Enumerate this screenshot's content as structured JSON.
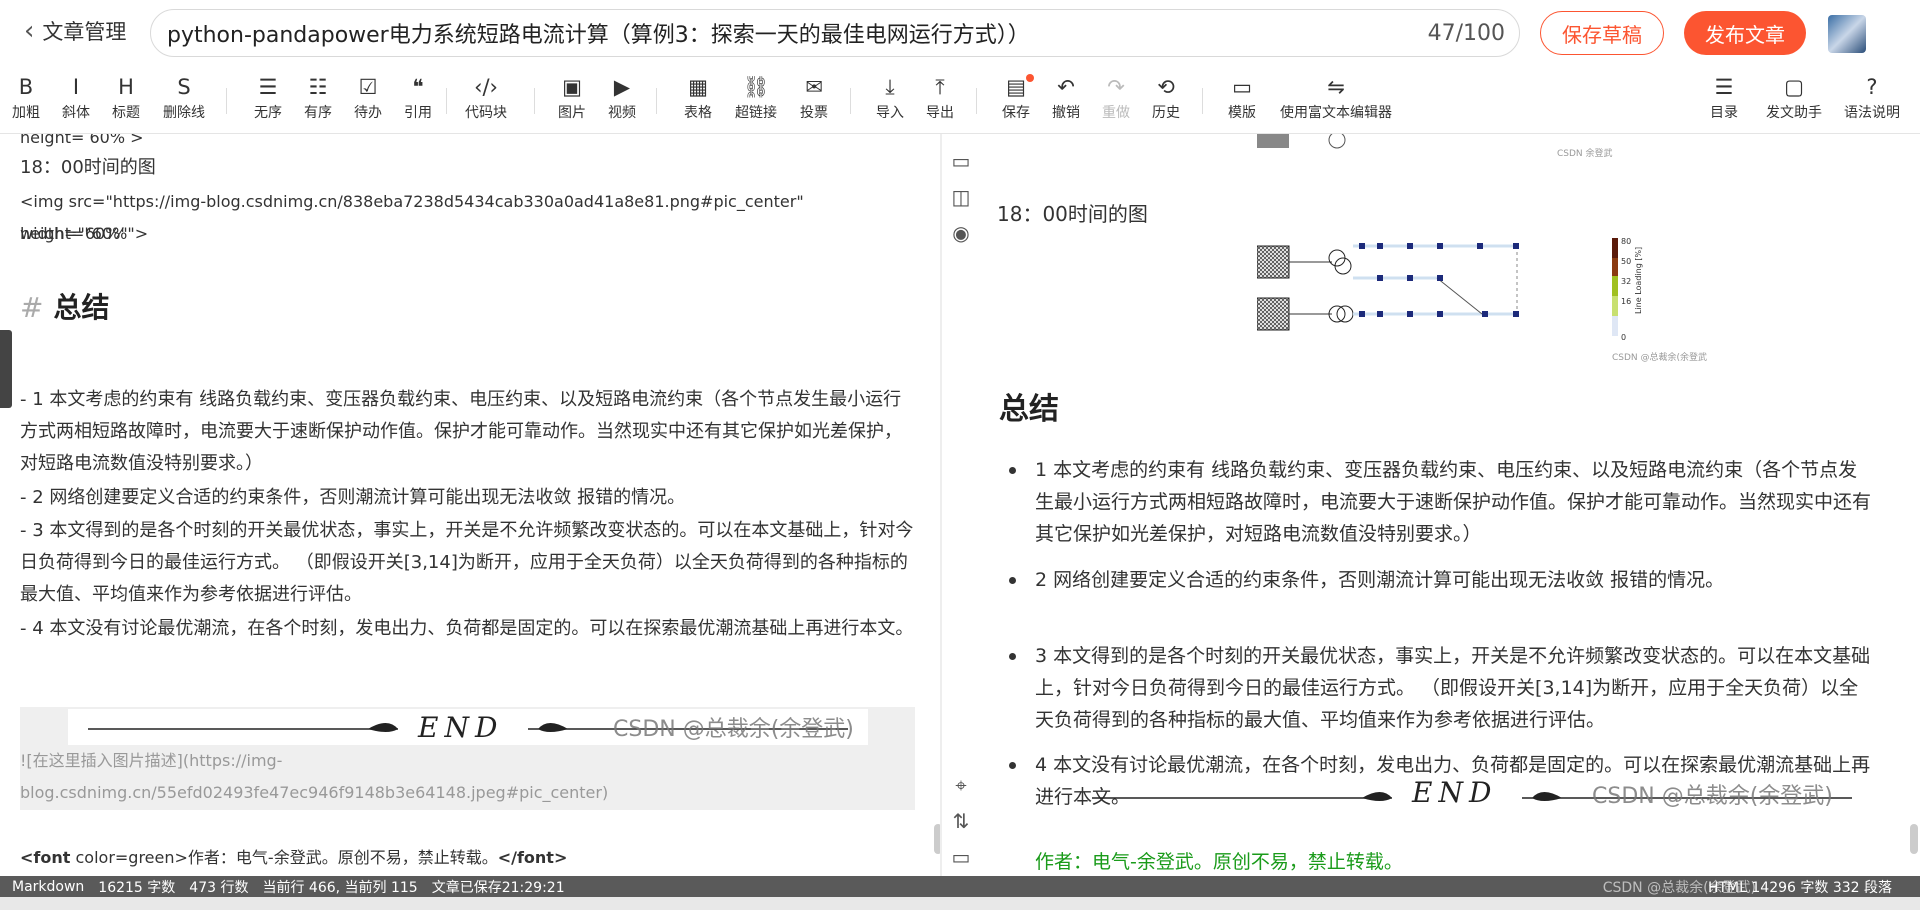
{
  "header": {
    "back_label": "文章管理",
    "title_value": "python-pandapower电力系统短路电流计算（算例3：探索一天的最佳电网运行方式））",
    "title_count": "47/100",
    "save_draft": "保存草稿",
    "publish": "发布文章"
  },
  "toolbar": {
    "items": [
      {
        "label": "加粗",
        "icon": "bold-icon",
        "glyph": "B"
      },
      {
        "label": "斜体",
        "icon": "italic-icon",
        "glyph": "I"
      },
      {
        "label": "标题",
        "icon": "heading-icon",
        "glyph": "H"
      },
      {
        "label": "删除线",
        "icon": "strikethrough-icon",
        "glyph": "S"
      },
      {
        "label": "无序",
        "icon": "unordered-list-icon",
        "glyph": "☰"
      },
      {
        "label": "有序",
        "icon": "ordered-list-icon",
        "glyph": "☷"
      },
      {
        "label": "待办",
        "icon": "todo-list-icon",
        "glyph": "☑"
      },
      {
        "label": "引用",
        "icon": "quote-icon",
        "glyph": "❝"
      },
      {
        "label": "代码块",
        "icon": "code-block-icon",
        "glyph": "‹/›"
      },
      {
        "label": "图片",
        "icon": "image-icon",
        "glyph": "▣"
      },
      {
        "label": "视频",
        "icon": "video-icon",
        "glyph": "▶"
      },
      {
        "label": "表格",
        "icon": "table-icon",
        "glyph": "▦"
      },
      {
        "label": "超链接",
        "icon": "link-icon",
        "glyph": "⛓"
      },
      {
        "label": "投票",
        "icon": "vote-icon",
        "glyph": "✉"
      },
      {
        "label": "导入",
        "icon": "import-icon",
        "glyph": "⤓"
      },
      {
        "label": "导出",
        "icon": "export-icon",
        "glyph": "⤒"
      },
      {
        "label": "保存",
        "icon": "save-icon",
        "glyph": "▤"
      },
      {
        "label": "撤销",
        "icon": "undo-icon",
        "glyph": "↶"
      },
      {
        "label": "重做",
        "icon": "redo-icon",
        "glyph": "↷"
      },
      {
        "label": "历史",
        "icon": "history-icon",
        "glyph": "⟲"
      },
      {
        "label": "模版",
        "icon": "template-icon",
        "glyph": "▭"
      },
      {
        "label": "使用富文本编辑器",
        "icon": "switch-editor-icon",
        "glyph": "⇋"
      },
      {
        "label": "目录",
        "icon": "toc-icon",
        "glyph": "☰"
      },
      {
        "label": "发文助手",
        "icon": "assistant-icon",
        "glyph": "▢"
      },
      {
        "label": "语法说明",
        "icon": "help-icon",
        "glyph": "?"
      }
    ]
  },
  "editor": {
    "line_partial": "height= 60% >",
    "line_time": "18：00时间的图",
    "img_tag_1": "<img src=\"https://img-blog.csdnimg.cn/838eba7238d5434cab330a0ad41a8e81.png#pic_center\" width=\"60%\"",
    "img_tag_2": "height=\"60%\">",
    "heading_hash": "#",
    "heading": "总结",
    "p1": "- 1 本文考虑的约束有 线路负载约束、变压器负载约束、电压约束、以及短路电流约束（各个节点发生最小运行方式两相短路故障时，电流要大于速断保护动作值。保护才能可靠动作。当然现实中还有其它保护如光差保护，对短路电流数值没特别要求。）",
    "p2": "- 2 网络创建要定义合适的约束条件，否则潮流计算可能出现无法收敛 报错的情况。",
    "p3": "- 3 本文得到的是各个时刻的开关最优状态，事实上，开关是不允许频繁改变状态的。可以在本文基础上，针对今日负荷得到今日的最佳运行方式。 （即假设开关[3,14]为断开，应用于全天负荷）以全天负荷得到的各种指标的最大值、平均值来作为参考依据进行评估。",
    "p4": "- 4  本文没有讨论最优潮流，在各个时刻，发电出力、负荷都是固定的。可以在探索最优潮流基础上再进行本文。",
    "end_text": "END",
    "watermark": "CSDN @总裁余(余登武)",
    "img_md_1": "![在这里插入图片描述](https://img-",
    "img_md_2": "blog.csdnimg.cn/55efd02493fe47ec946f9148b3e64148.jpeg#pic_center)",
    "font_line_open": "<font",
    "font_line_attr": " color=green>",
    "font_line_text": "作者：电气-余登武。原创不易，禁止转载。",
    "font_line_close": "</font>"
  },
  "preview": {
    "time_label": "18：00时间的图",
    "legend_ticks": [
      "80",
      "50",
      "32",
      "16",
      "0"
    ],
    "legend_title": "Line Loading [%]",
    "img_watermark": "CSDN @总裁余(余登武)",
    "heading": "总结",
    "items": [
      "1 本文考虑的约束有 线路负载约束、变压器负载约束、电压约束、以及短路电流约束（各个节点发生最小运行方式两相短路故障时，电流要大于速断保护动作值。保护才能可靠动作。当然现实中还有其它保护如光差保护，对短路电流数值没特别要求。）",
      "2 网络创建要定义合适的约束条件，否则潮流计算可能出现无法收敛 报错的情况。",
      "3 本文得到的是各个时刻的开关最优状态，事实上，开关是不允许频繁改变状态的。可以在本文基础上，针对今日负荷得到今日的最佳运行方式。 （即假设开关[3,14]为断开，应用于全天负荷）以全天负荷得到的各种指标的最大值、平均值来作为参考依据进行评估。",
      "4 本文没有讨论最优潮流，在各个时刻，发电出力、负荷都是固定的。可以在探索最优潮流基础上再进行本文。"
    ],
    "end_text": "END",
    "watermark": "CSDN @总裁余(余登武)",
    "author_line": "作者：电气-余登武。原创不易，禁止转载。"
  },
  "status": {
    "mode": "Markdown",
    "chars": "16215 字数",
    "lines": "473 行数",
    "cursor": "当前行 466, 当前列 115",
    "saved": "文章已保存21:29:21",
    "right": "HTML 14296 字数 332 段落",
    "right_wm": "CSDN @总裁余(余登武)"
  },
  "colors": {
    "accent": "#fc5531",
    "author_green": "#1a9b1a",
    "status_bg": "#5a5a5a"
  }
}
